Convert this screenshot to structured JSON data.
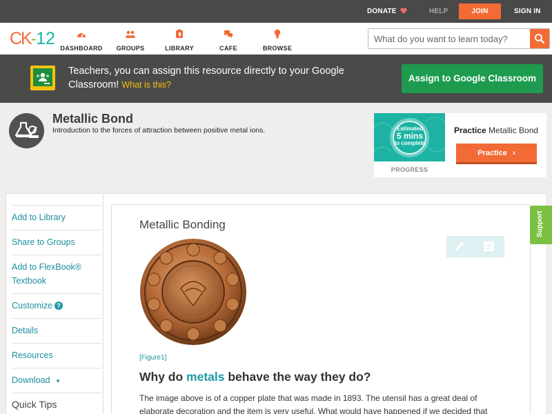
{
  "topbar": {
    "donate": "DONATE",
    "help": "HELP",
    "join": "JOIN",
    "signin": "SIGN IN"
  },
  "logo": {
    "ck": "CK",
    "dash": "-",
    "num": "12"
  },
  "nav": {
    "dashboard": "DASHBOARD",
    "groups": "GROUPS",
    "library": "LIBRARY",
    "cafe": "CAFE",
    "browse": "BROWSE"
  },
  "search": {
    "placeholder": "What do you want to learn today?"
  },
  "banner": {
    "text": "Teachers, you can assign this resource directly to your Google Classroom!",
    "what_link": "What is this?",
    "assign_button": "Assign to Google Classroom"
  },
  "header": {
    "title": "Metallic Bond",
    "subtitle": "Introduction to the forces of attraction between positive metal ions."
  },
  "practice": {
    "estimated": "Estimated",
    "mins": "5 mins",
    "to_complete": "to complete",
    "progress_label": "PROGRESS",
    "title_prefix": "Practice",
    "title_topic": "Metallic Bond",
    "button": "Practice"
  },
  "sidebar": {
    "items": [
      "Add to Library",
      "Share to Groups",
      "Add to FlexBook® Textbook",
      "Customize",
      "Details",
      "Resources",
      "Download"
    ],
    "quick_tips": "Quick Tips"
  },
  "content": {
    "section_title": "Metallic Bonding",
    "figure_label": "[Figure1]",
    "question_pre": "Why do ",
    "question_link": "metals",
    "question_post": " behave the way they do?",
    "body": "The image above is of a copper plate that was made in 1893.  The utensil has a great deal of elaborate decoration and the item is very useful.  What would have happened if we decided that"
  },
  "support": {
    "label": "Support"
  },
  "colors": {
    "accent": "#f26b36",
    "teal": "#1db3a4",
    "link": "#1c8fa0",
    "google_green": "#1e9b4f",
    "support_green": "#7bc043"
  },
  "icons": {
    "search": "search-icon",
    "heart": "heart-icon",
    "google_classroom": "google-classroom-icon",
    "chemistry": "flask-icon",
    "pencil": "pencil-icon",
    "notes": "notes-icon"
  }
}
